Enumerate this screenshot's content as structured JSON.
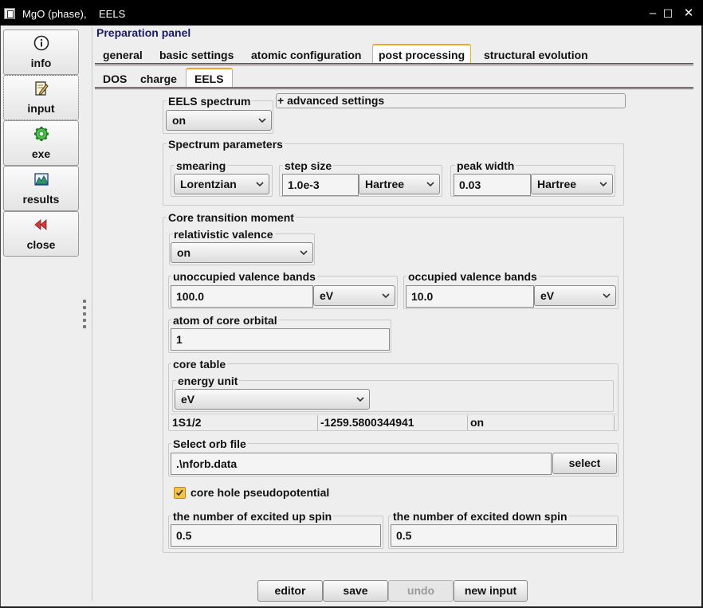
{
  "window": {
    "title": "MgO (phase),",
    "subtitle": "EELS",
    "minimize_glyph": "–",
    "maximize_glyph": "☐",
    "close_glyph": "✕"
  },
  "sidebar": {
    "items": [
      {
        "label": "info",
        "icon": "info-icon"
      },
      {
        "label": "input",
        "icon": "edit-icon"
      },
      {
        "label": "exe",
        "icon": "gear-icon"
      },
      {
        "label": "results",
        "icon": "chart-icon"
      },
      {
        "label": "close",
        "icon": "rewind-icon"
      }
    ]
  },
  "panel": {
    "title": "Preparation panel",
    "tabs": [
      {
        "label": "general",
        "active": false
      },
      {
        "label": "basic settings",
        "active": false
      },
      {
        "label": "atomic configuration",
        "active": false
      },
      {
        "label": "post processing",
        "active": true
      },
      {
        "label": "structural evolution",
        "active": false
      }
    ],
    "subtabs": [
      {
        "label": "DOS",
        "active": false
      },
      {
        "label": "charge",
        "active": false
      },
      {
        "label": "EELS",
        "active": true
      }
    ]
  },
  "eels": {
    "spectrum_title": "EELS spectrum",
    "spectrum_value": "on",
    "advanced_label": "+ advanced settings",
    "params": {
      "title": "Spectrum parameters",
      "smearing_title": "smearing",
      "smearing_value": "Lorentzian",
      "step_title": "step size",
      "step_value": "1.0e-3",
      "step_unit": "Hartree",
      "peak_title": "peak width",
      "peak_value": "0.03",
      "peak_unit": "Hartree"
    },
    "core": {
      "title": "Core transition moment",
      "relval_title": "relativistic valence",
      "relval_value": "on",
      "unocc_title": "unoccupied valence bands",
      "unocc_value": "100.0",
      "unocc_unit": "eV",
      "occ_title": "occupied valence bands",
      "occ_value": "10.0",
      "occ_unit": "eV",
      "atom_title": "atom of core orbital",
      "atom_value": "1",
      "table_title": "core table",
      "energy_unit_title": "energy unit",
      "energy_unit_value": "eV",
      "row": [
        "1S1/2",
        "-1259.5800344941",
        "on"
      ],
      "orb_title": "Select orb file",
      "orb_value": ".\\nforb.data",
      "select_label": "select",
      "corehole_label": "core hole pseudopotential",
      "corehole_checked": true,
      "up_title": "the number of excited up spin",
      "up_value": "0.5",
      "down_title": "the number of excited down spin",
      "down_value": "0.5"
    }
  },
  "buttons": {
    "editor": "editor",
    "save": "save",
    "undo": "undo",
    "new_input": "new input"
  },
  "colors": {
    "accent_tab": "#f2a52d",
    "panel_title": "#1a1a6e",
    "checkbox": "#f6c243"
  }
}
